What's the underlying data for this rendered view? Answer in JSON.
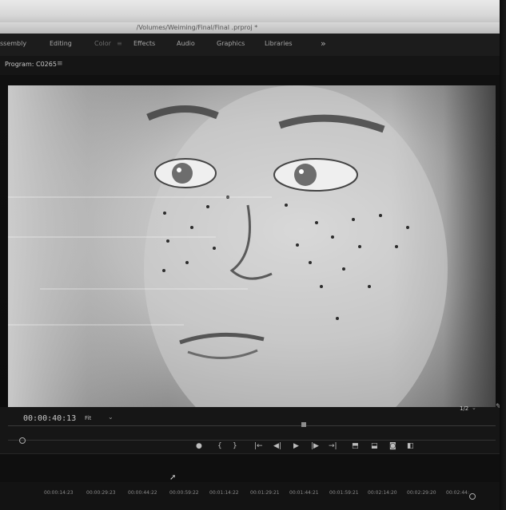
{
  "window": {
    "title": "/Volumes/Weiming/Final/Final .prproj *"
  },
  "workspaces": {
    "tabs": [
      {
        "label": "ssembly",
        "dim": false
      },
      {
        "label": "Editing",
        "dim": false
      },
      {
        "label": "Color",
        "dim": true
      },
      {
        "label": "Effects",
        "dim": false
      },
      {
        "label": "Audio",
        "dim": false
      },
      {
        "label": "Graphics",
        "dim": false
      },
      {
        "label": "Libraries",
        "dim": false
      }
    ],
    "more_icon": "»"
  },
  "program_monitor": {
    "label": "Program: C0265",
    "menu_icon": "≡",
    "timecode": "00:00:40:13",
    "fit": "Fit",
    "page": "1/2"
  },
  "transport": {
    "buttons": [
      {
        "name": "add-marker-button",
        "glyph": "●"
      },
      {
        "name": "mark-in-button",
        "glyph": "{"
      },
      {
        "name": "mark-out-button",
        "glyph": "}"
      },
      {
        "name": "go-to-in-button",
        "glyph": "|←"
      },
      {
        "name": "step-back-button",
        "glyph": "◀|"
      },
      {
        "name": "play-button",
        "glyph": "▶"
      },
      {
        "name": "step-forward-button",
        "glyph": "|▶"
      },
      {
        "name": "go-to-out-button",
        "glyph": "→|"
      },
      {
        "name": "lift-button",
        "glyph": "⬒"
      },
      {
        "name": "extract-button",
        "glyph": "⬓"
      },
      {
        "name": "export-frame-button",
        "glyph": "◙"
      },
      {
        "name": "comparison-view-button",
        "glyph": "◧"
      }
    ]
  },
  "timeline_ruler": {
    "ticks": [
      "00:00:14:23",
      "00:00:29:23",
      "00:00:44:22",
      "00:00:59:22",
      "00:01:14:22",
      "00:01:29:21",
      "00:01:44:21",
      "00:01:59:21",
      "00:02:14:20",
      "00:02:29:20",
      "00:02:44:"
    ]
  },
  "colors": {
    "panel_bg": "#161616",
    "text": "#c8c8c8",
    "accent": "#bdbdbd"
  }
}
